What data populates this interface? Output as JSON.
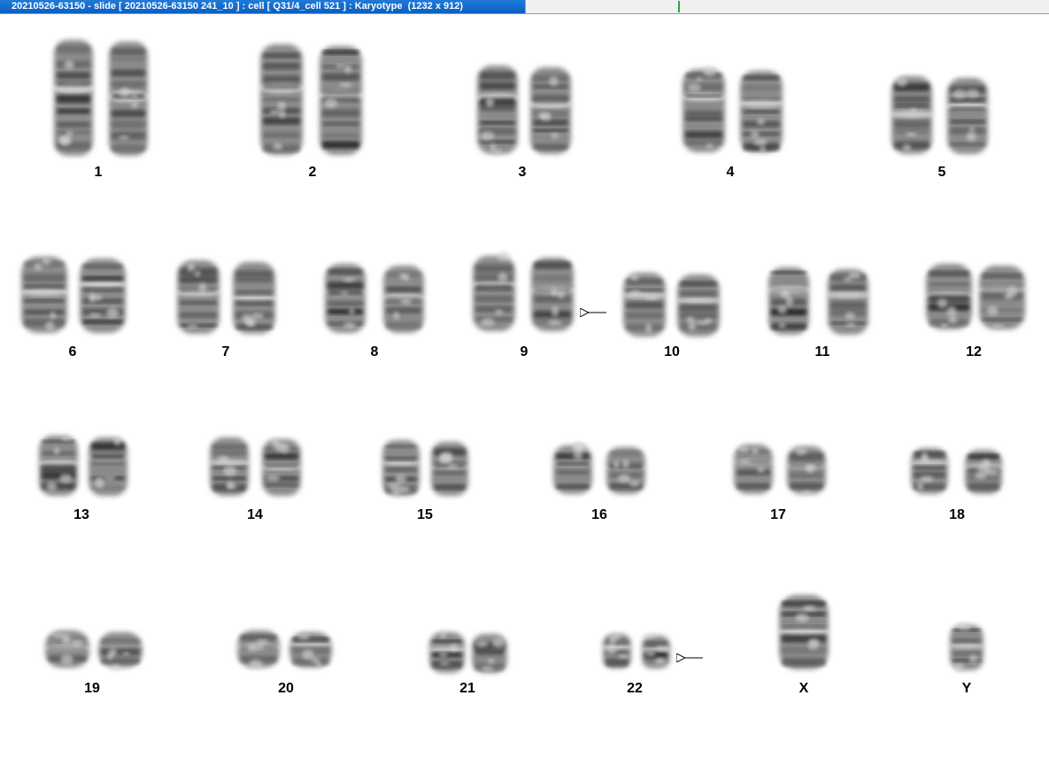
{
  "window": {
    "title": "20210526-63150 - slide [ 20210526-63150 241_10 ] : cell [ Q31/4_cell 521 ] : Karyotype  (1232 x 912)",
    "status_color": "#2ea82e",
    "title_color": "#0a5fc0"
  },
  "karyotype": {
    "chromosomes": [
      {
        "label": "1",
        "row": 1
      },
      {
        "label": "2",
        "row": 1
      },
      {
        "label": "3",
        "row": 1
      },
      {
        "label": "4",
        "row": 1
      },
      {
        "label": "5",
        "row": 1
      },
      {
        "label": "6",
        "row": 2
      },
      {
        "label": "7",
        "row": 2
      },
      {
        "label": "8",
        "row": 2
      },
      {
        "label": "9",
        "row": 2,
        "marked": true
      },
      {
        "label": "10",
        "row": 2
      },
      {
        "label": "11",
        "row": 2
      },
      {
        "label": "12",
        "row": 2
      },
      {
        "label": "13",
        "row": 3
      },
      {
        "label": "14",
        "row": 3
      },
      {
        "label": "15",
        "row": 3
      },
      {
        "label": "16",
        "row": 3
      },
      {
        "label": "17",
        "row": 3
      },
      {
        "label": "18",
        "row": 3
      },
      {
        "label": "19",
        "row": 4
      },
      {
        "label": "20",
        "row": 4
      },
      {
        "label": "21",
        "row": 4
      },
      {
        "label": "22",
        "row": 4,
        "marked": true
      },
      {
        "label": "X",
        "row": 4
      },
      {
        "label": "Y",
        "row": 4
      }
    ]
  }
}
